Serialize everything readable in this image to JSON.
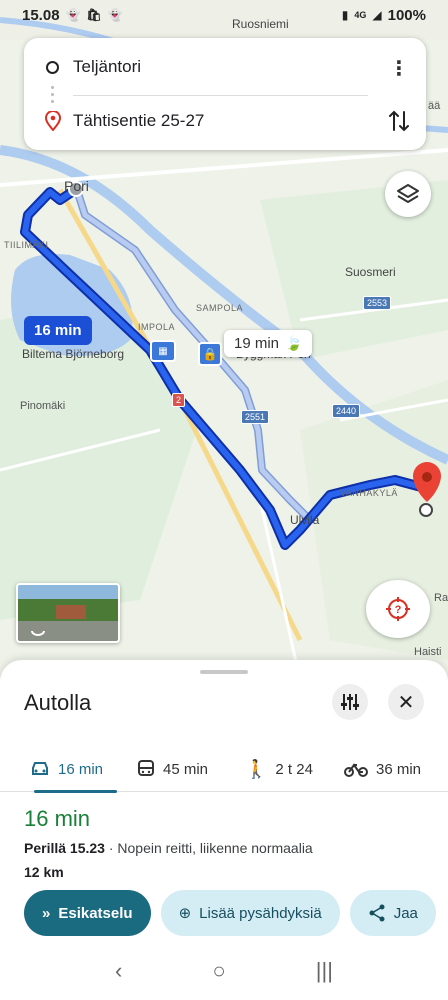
{
  "status_bar": {
    "time": "15.08",
    "network": "4G",
    "battery": "100%",
    "icons": [
      "snapchat-icon",
      "bag-icon",
      "snapchat-icon",
      "battery-saver-icon",
      "signal-icon",
      "battery-icon"
    ]
  },
  "search": {
    "origin": "Teljäntori",
    "destination": "Tähtisentie 25-27",
    "more_icon": "more-vert-icon",
    "swap_icon": "swap-icon"
  },
  "map": {
    "labels": {
      "ruosniemi": "Ruosniemi",
      "pori": "Pori",
      "tiilimaki": "TIILIMÄKI",
      "sampola": "SAMPOLA",
      "impola": "IMPOLA",
      "biltema": "Biltema Björneborg",
      "byggmax": "Byggmax Pori",
      "pinomaki": "Pinomäki",
      "suosmeri": "Suosmeri",
      "ulvila": "Ulvila",
      "vanhakyla": "VANHAKYLÄ",
      "haistila": "Haisti",
      "ra": "Ra",
      "aa": "ää"
    },
    "road_shields": {
      "r2553": "2553",
      "r2440": "2440",
      "r2551": "2551",
      "r2": "2"
    },
    "route_main_time": "16 min",
    "route_alt_time": "19 min",
    "colors": {
      "route_main": "#1a4fd6",
      "route_alt": "#a8bde9",
      "water": "#aecbf0",
      "pin": "#ea4335"
    }
  },
  "sheet": {
    "title": "Autolla",
    "modes": [
      {
        "icon": "car-icon",
        "label": "16 min",
        "active": true
      },
      {
        "icon": "transit-icon",
        "label": "45 min",
        "active": false
      },
      {
        "icon": "walk-icon",
        "label": "2 t 24",
        "active": false
      },
      {
        "icon": "bike-icon",
        "label": "36 min",
        "active": false
      }
    ],
    "summary": {
      "time": "16 min",
      "arrival": "Perillä 15.23",
      "description": " · Nopein reitti, liikenne normaalia",
      "distance": "12 km"
    },
    "actions": {
      "preview": "Esikatselu",
      "add_stops": "Lisää pysähdyksiä",
      "share": "Jaa"
    }
  }
}
